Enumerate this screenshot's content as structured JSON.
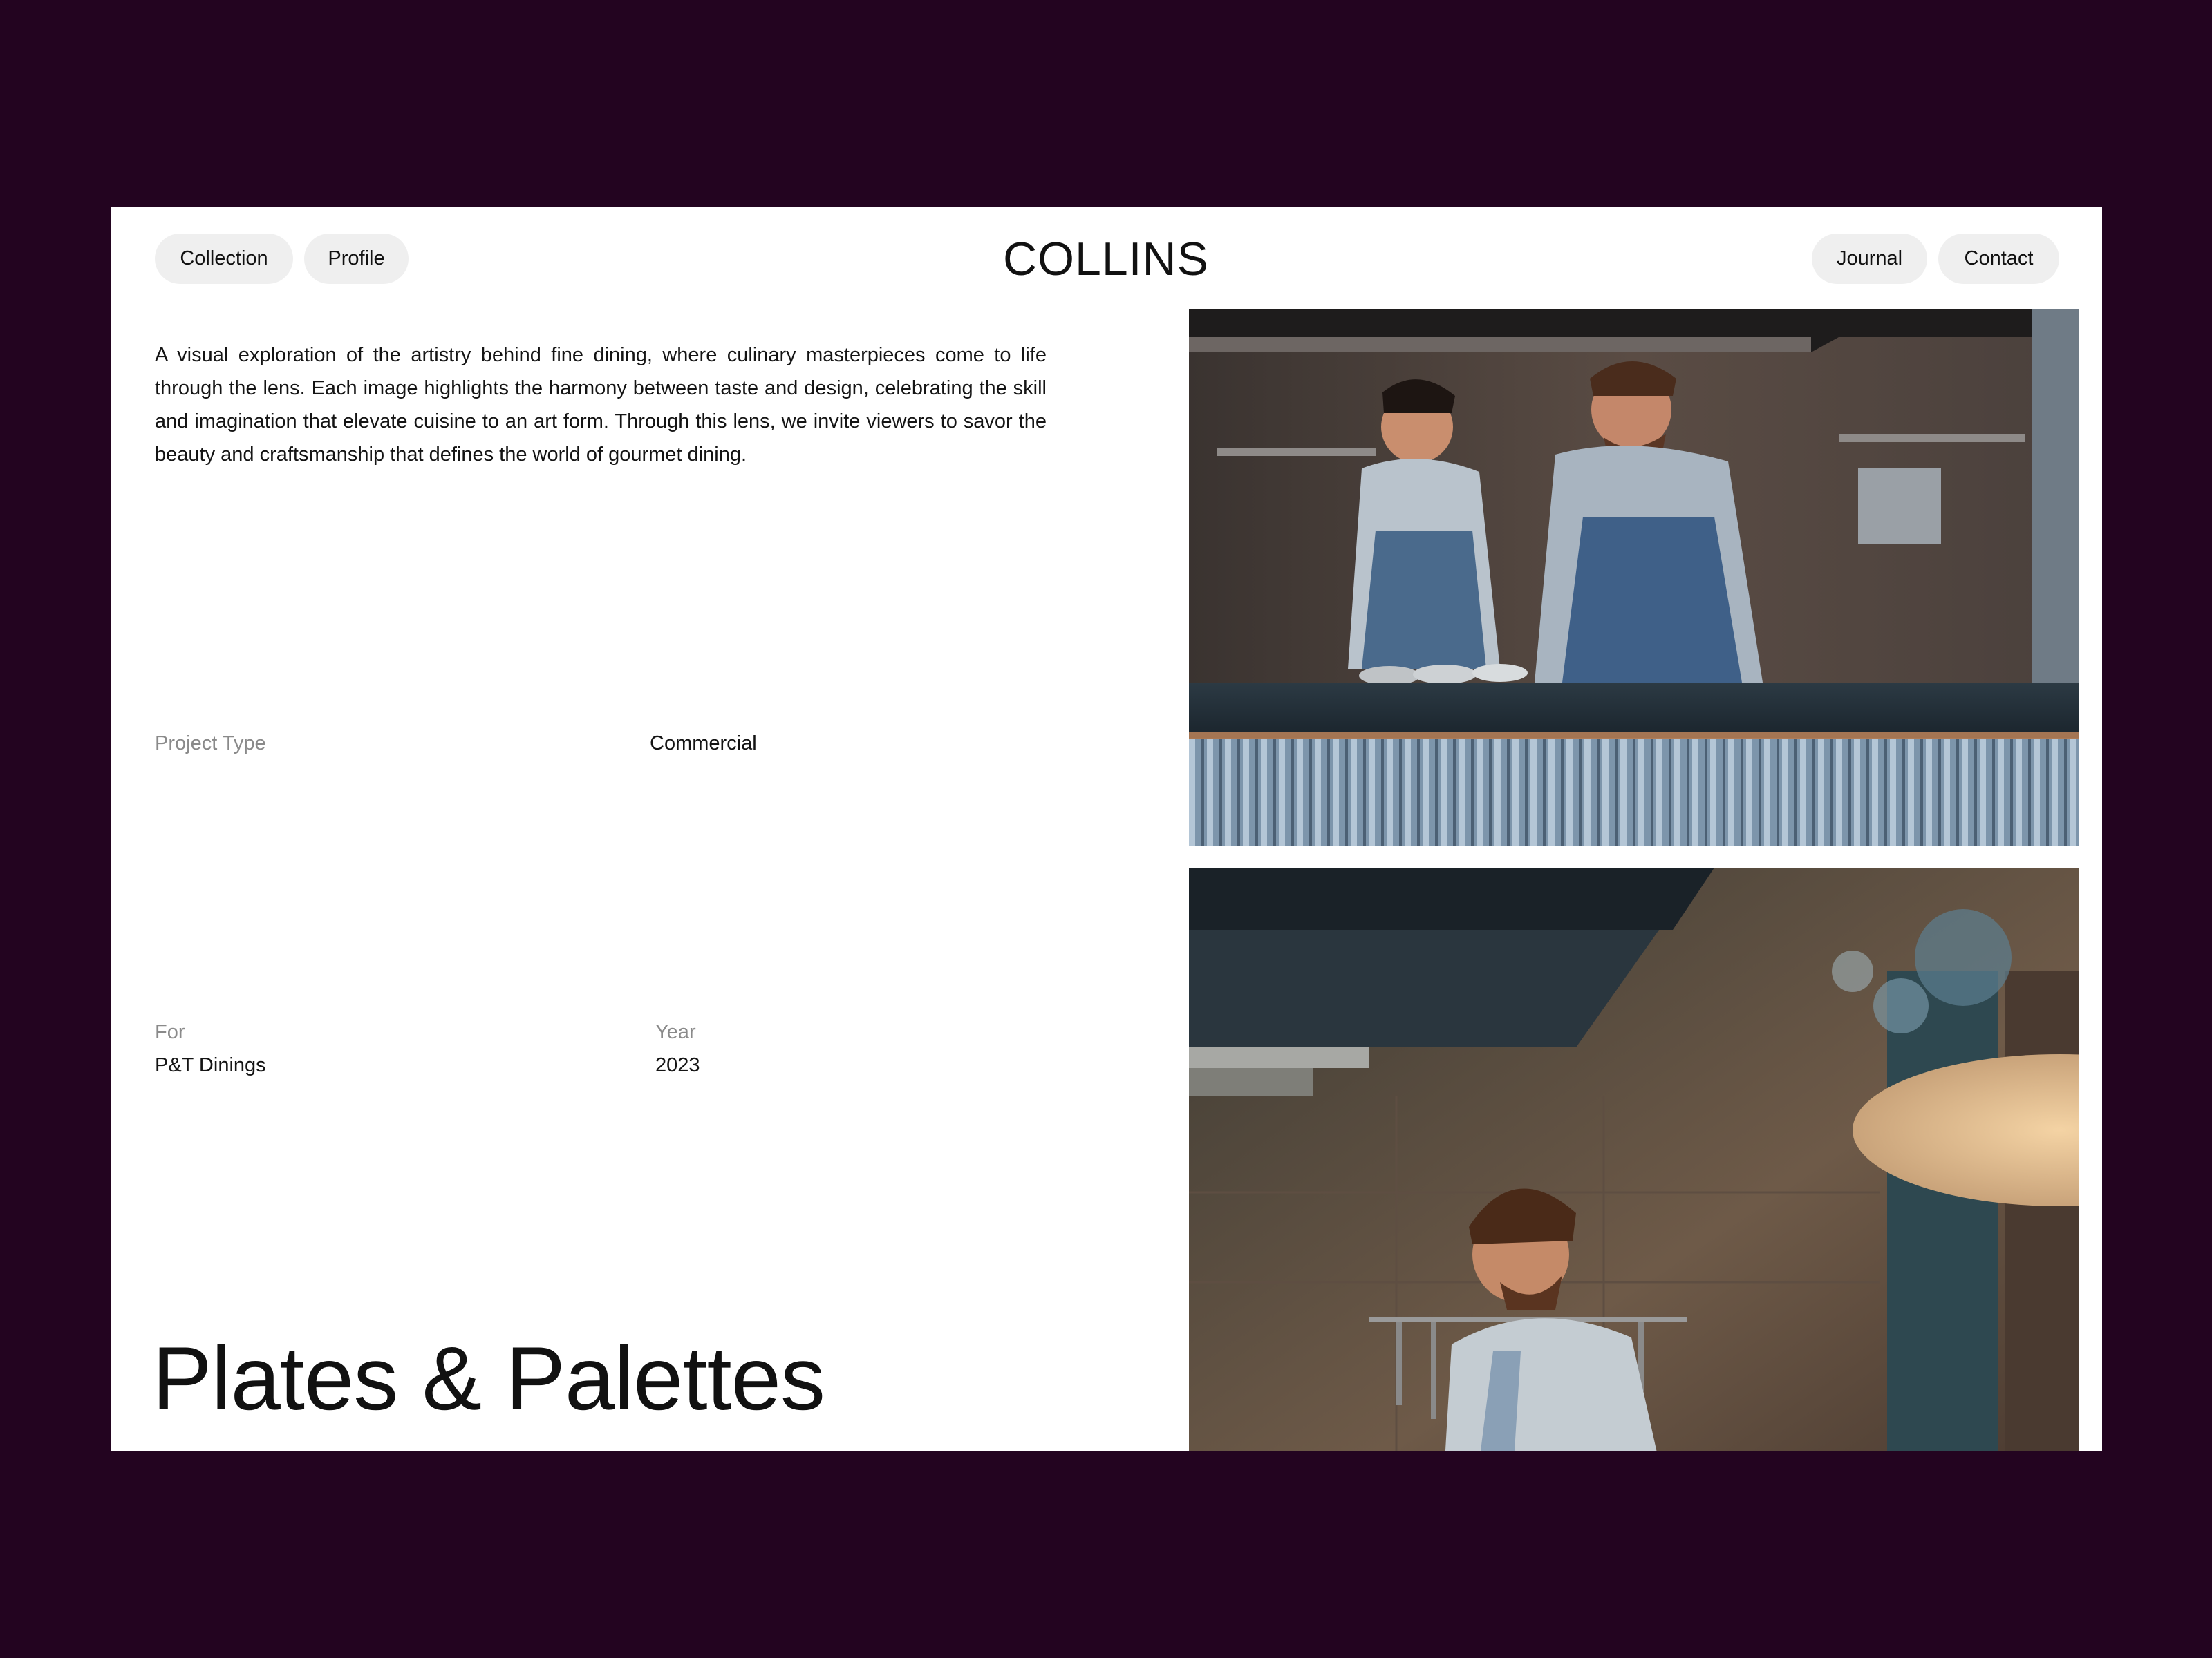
{
  "nav": {
    "left": [
      {
        "label": "Collection"
      },
      {
        "label": "Profile"
      }
    ],
    "logo": "COLLINS",
    "right": [
      {
        "label": "Journal"
      },
      {
        "label": "Contact"
      }
    ]
  },
  "intro": "A visual exploration of the artistry behind fine dining, where culinary masterpieces come to life through the lens. Each image highlights the harmony between taste and design, celebrating the skill and imagination that elevate cuisine to an art form. Through this lens, we invite viewers to savor the beauty and craftsmanship that defines the world of gourmet dining.",
  "meta": {
    "project_type_label": "Project Type",
    "project_type_value": "Commercial",
    "for_label": "For",
    "for_value": "P&T Dinings",
    "year_label": "Year",
    "year_value": "2023"
  },
  "project_title": "Plates & Palettes",
  "photos": [
    {
      "subject": "two-chefs-plating-at-kitchen-counter"
    },
    {
      "subject": "chef-working-under-kitchen-hood"
    }
  ],
  "colors": {
    "backdrop": "#230420",
    "page": "#ffffff",
    "pill": "#efefef",
    "muted_text": "#8a8a8a"
  }
}
